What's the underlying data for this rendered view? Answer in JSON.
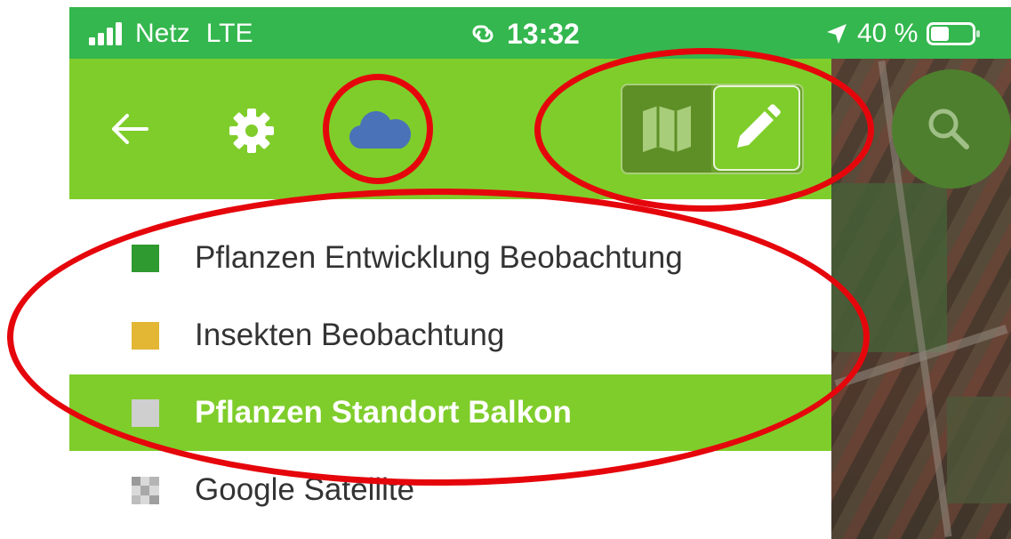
{
  "status_bar": {
    "carrier": "Netz",
    "network": "LTE",
    "time": "13:32",
    "battery": "40 %",
    "bg_color": "#34b74e"
  },
  "toolbar": {
    "back_icon": "arrow-left-icon",
    "settings_icon": "gear-icon",
    "cloud_icon": "cloud-icon",
    "map_toggle_icon": "map-icon",
    "edit_toggle_icon": "pencil-icon",
    "bg_color": "#7fcd2b",
    "cloud_color": "#4a72b8"
  },
  "layers": [
    {
      "label": "Pflanzen Entwicklung Beobachtung",
      "color": "#2f9a2f",
      "active": false
    },
    {
      "label": "Insekten Beobachtung",
      "color": "#e3b634",
      "active": false
    },
    {
      "label": "Pflanzen Standort Balkon",
      "color": "#cfcfcf",
      "active": true
    },
    {
      "label": "Google Satellite",
      "color": "checker",
      "active": false
    }
  ],
  "map": {
    "search_icon": "search-icon"
  },
  "annotation_color": "#e5060c"
}
